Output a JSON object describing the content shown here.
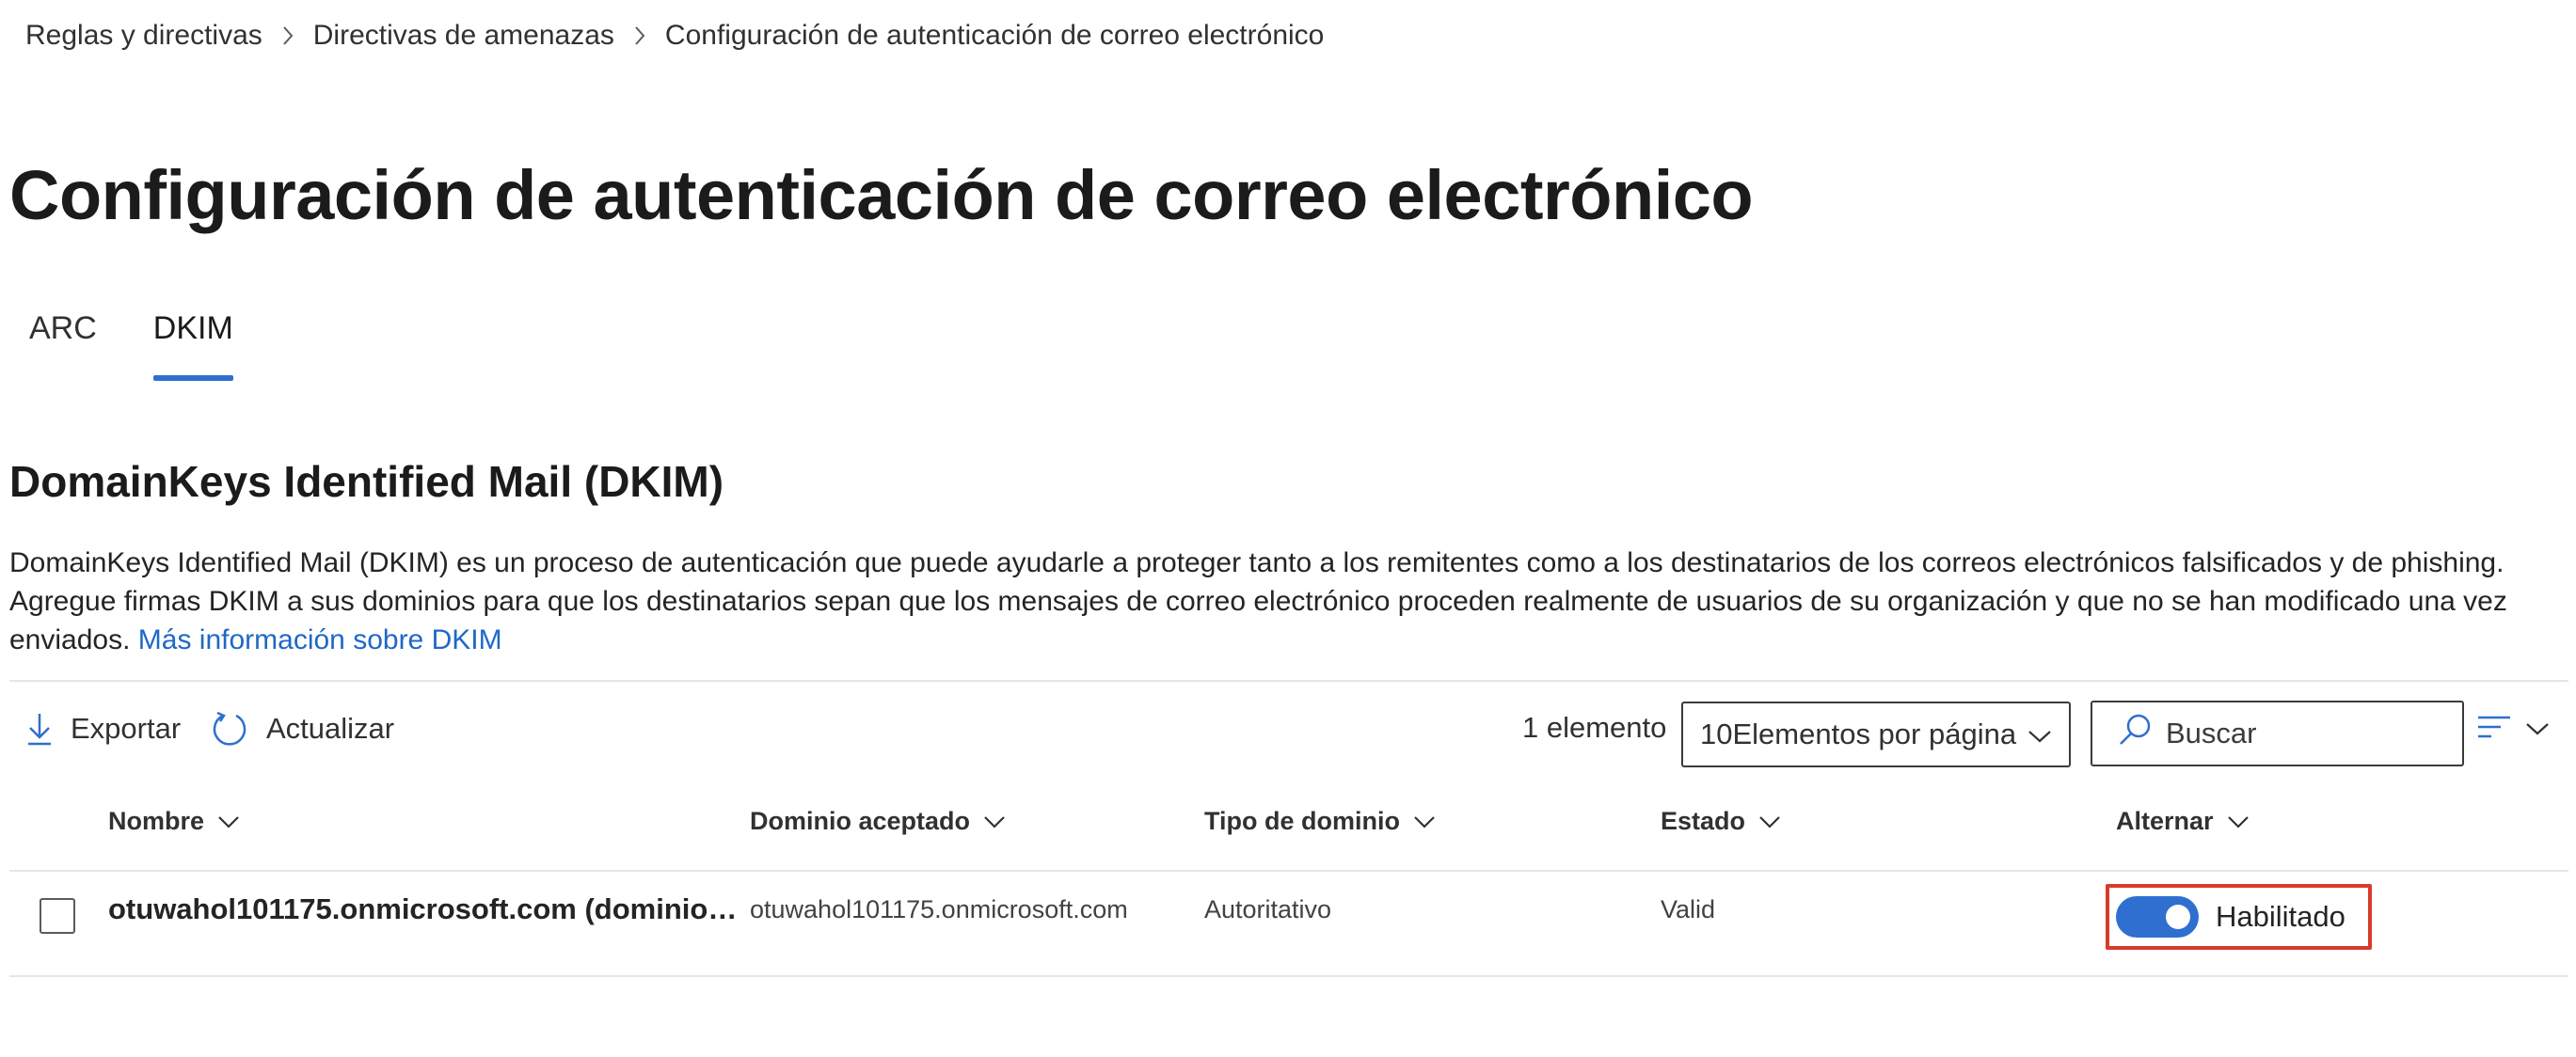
{
  "breadcrumb": {
    "items": [
      "Reglas y directivas",
      "Directivas de amenazas",
      "Configuración de autenticación de correo electrónico"
    ]
  },
  "page": {
    "title": "Configuración de autenticación de correo electrónico"
  },
  "tabs": [
    {
      "label": "ARC",
      "active": false
    },
    {
      "label": "DKIM",
      "active": true
    }
  ],
  "section": {
    "title": "DomainKeys Identified Mail (DKIM)",
    "description": "DomainKeys Identified Mail (DKIM) es un proceso de autenticación que puede ayudarle a proteger tanto a los remitentes como a los destinatarios de los correos electrónicos falsificados y de phishing. Agregue firmas DKIM a sus dominios para que los destinatarios sepan que los mensajes de correo electrónico proceden realmente de usuarios de su organización y que no se han modificado una vez enviados.",
    "learn_more": "Más información sobre DKIM"
  },
  "toolbar": {
    "export_label": "Exportar",
    "refresh_label": "Actualizar",
    "count": "1 elemento",
    "page_size": "10Elementos por página",
    "search_placeholder": "Buscar"
  },
  "table": {
    "columns": [
      "Nombre",
      "Dominio aceptado",
      "Tipo de dominio",
      "Estado",
      "Alternar"
    ],
    "rows": [
      {
        "name": "otuwahol101175.onmicrosoft.com (dominio de…",
        "domain": "otuwahol101175.onmicrosoft.com",
        "type": "Autoritativo",
        "status": "Valid",
        "toggle_label": "Habilitado",
        "toggle_on": true
      }
    ]
  },
  "colors": {
    "accent": "#2f6fd0",
    "link": "#1f68c7",
    "highlight_border": "#d83b2b"
  }
}
